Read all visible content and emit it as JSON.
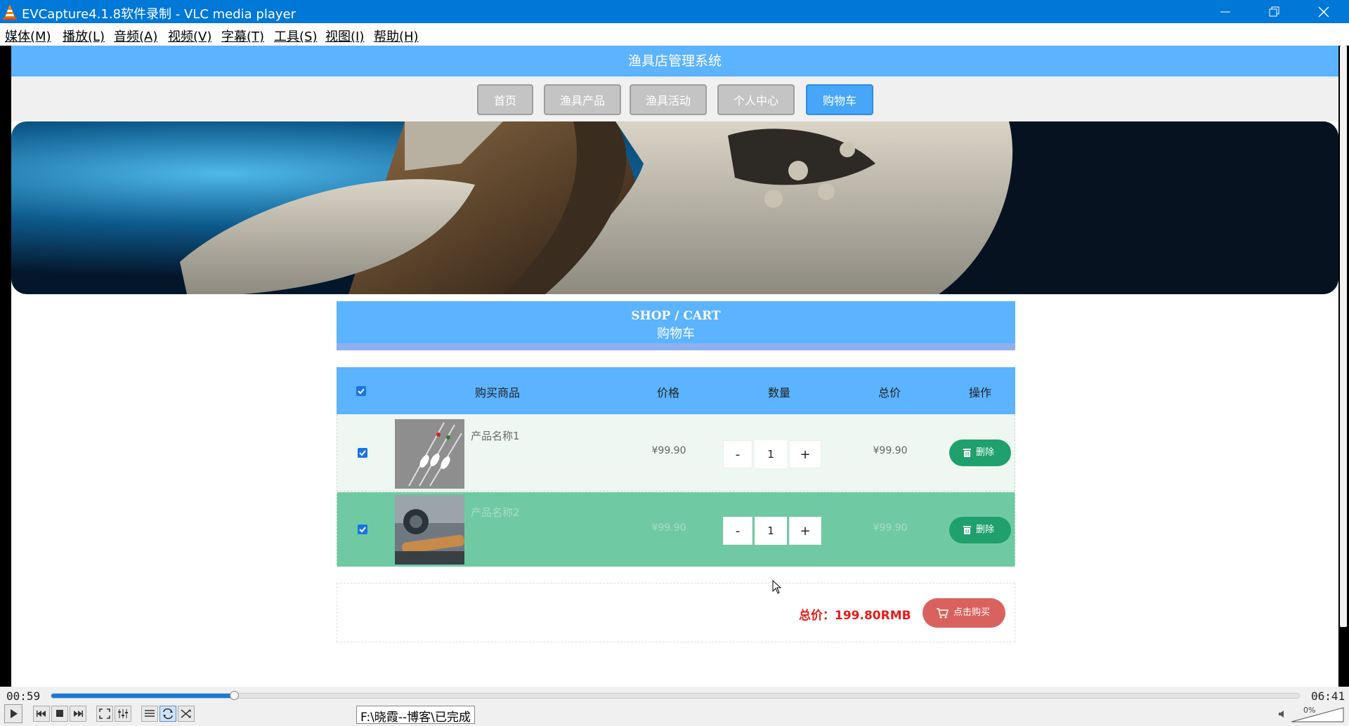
{
  "window": {
    "title": "EVCapture4.1.8软件录制 - VLC media player",
    "app_icon": "vlc-cone-icon"
  },
  "menu": [
    {
      "label": "媒体(M)"
    },
    {
      "label": "播放(L)"
    },
    {
      "label": "音频(A)"
    },
    {
      "label": "视频(V)"
    },
    {
      "label": "字幕(T)"
    },
    {
      "label": "工具(S)"
    },
    {
      "label": "视图(I)"
    },
    {
      "label": "帮助(H)"
    }
  ],
  "site": {
    "title": "渔具店管理系统",
    "nav": [
      {
        "label": "首页"
      },
      {
        "label": "渔具产品"
      },
      {
        "label": "渔具活动"
      },
      {
        "label": "个人中心"
      },
      {
        "label": "购物车",
        "active": true
      }
    ],
    "banner": "sea-turtle-underwater-photo"
  },
  "cart": {
    "heading_en": "SHOP / CART",
    "heading_zh": "购物车",
    "columns": [
      "购买商品",
      "价格",
      "数量",
      "总价",
      "操作"
    ],
    "select_all_checked": true,
    "items": [
      {
        "name": "产品名称1",
        "price": "¥99.90",
        "quantity": "1",
        "subtotal": "¥99.90",
        "checked": true,
        "delete_label": "删除",
        "minus": "-",
        "plus": "+",
        "image": "fishing-floats-photo"
      },
      {
        "name": "产品名称2",
        "price": "¥99.90",
        "quantity": "1",
        "subtotal": "¥99.90",
        "checked": true,
        "delete_label": "删除",
        "minus": "-",
        "plus": "+",
        "image": "fishing-reel-rod-photo"
      }
    ],
    "total_label": "总价：199.80RMB",
    "buy_label": "点击购买"
  },
  "player": {
    "elapsed": "00:59",
    "duration": "06:41",
    "progress": 0.147,
    "status_tooltip": "F:\\晓霞--博客\\已完成",
    "volume_label": "0%",
    "colors": {
      "accent": "#1a7bd6",
      "titlebar": "#0078d7",
      "header": "#5cb3ff",
      "selected_row": "#6fcaa4",
      "delete": "#1fa06c",
      "buy": "#d9625f",
      "total": "#e21c1c"
    }
  }
}
